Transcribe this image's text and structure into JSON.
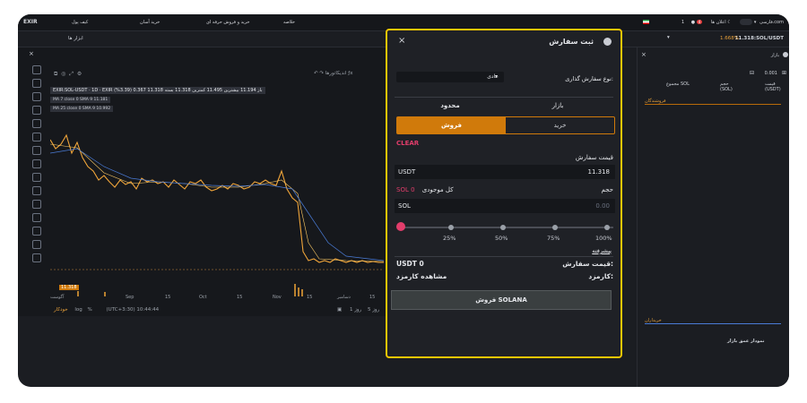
{
  "topnav": {
    "logo": "EXIR",
    "items": [
      "کیف پول",
      "خرید آسان",
      "خرید و فروش حرفه ای",
      "خلاصه"
    ],
    "language": "فارسی",
    "notifications_label": "اعلان ها",
    "notifications_count": "4",
    "user": "1.com"
  },
  "bar2": {
    "tools_label": "ابزار ها",
    "ticker": "11.318:SOL/USDT",
    "change": "1.668%"
  },
  "chart": {
    "ohlc": "EXIR:SOL-USDT · 1D · EXIR   باز 11.194  بیشترین 11.495  کمترین 11.318  بسته 11.318  0.367 (3.39%)",
    "ma7": "MA 7 close 0 SMA 9  11.181",
    "ma25": "MA 25 close 0 SMA 9  10.992",
    "indicators_label": "اندیکاتورها",
    "price_tag": "11.318",
    "x_labels": [
      "آگوست",
      "Sep",
      "15",
      "Oct",
      "15",
      "Nov",
      "15",
      "دسامبر",
      "15"
    ],
    "range_labels": [
      "5 روز",
      "1 روز"
    ],
    "timezone": "(UTC+3:30) 10:44:44",
    "bottom_opts": [
      "%",
      "log",
      "خودکار"
    ]
  },
  "orderbook": {
    "title": "بازار",
    "price_size": "0.001",
    "headers": [
      "قیمت (USDT)",
      "حجم (SOL)",
      "مجموع SOL"
    ],
    "sellers_label": "فروشندگان",
    "buyers_label": "خریداران",
    "depth_label": "نمودار عمق بازار"
  },
  "modal": {
    "title": "ثبت سفارش",
    "order_type_label": "نوع سفارش گذاری:",
    "order_type_value": "عادی",
    "tabs": [
      "بازار",
      "محدود"
    ],
    "buy_label": "خرید",
    "sell_label": "فروش",
    "clear_label": "CLEAR",
    "price_label": "قیمت سفارش",
    "price_unit": "USDT",
    "price_value": "11.318",
    "volume_label": "حجم",
    "available_label": "کل موجودی",
    "available_value": "SOL 0",
    "volume_unit": "SOL",
    "volume_value": "0.00",
    "slider_marks": [
      "25%",
      "50%",
      "75%",
      "100%"
    ],
    "advanced_label": "پیشرفته",
    "order_price_label": "قیمت سفارش:",
    "order_price_value": "USDT 0",
    "fee_label": "کارمزد:",
    "fee_value": "مشاهده کارمزد",
    "submit_label": "فروش SOLANA"
  }
}
